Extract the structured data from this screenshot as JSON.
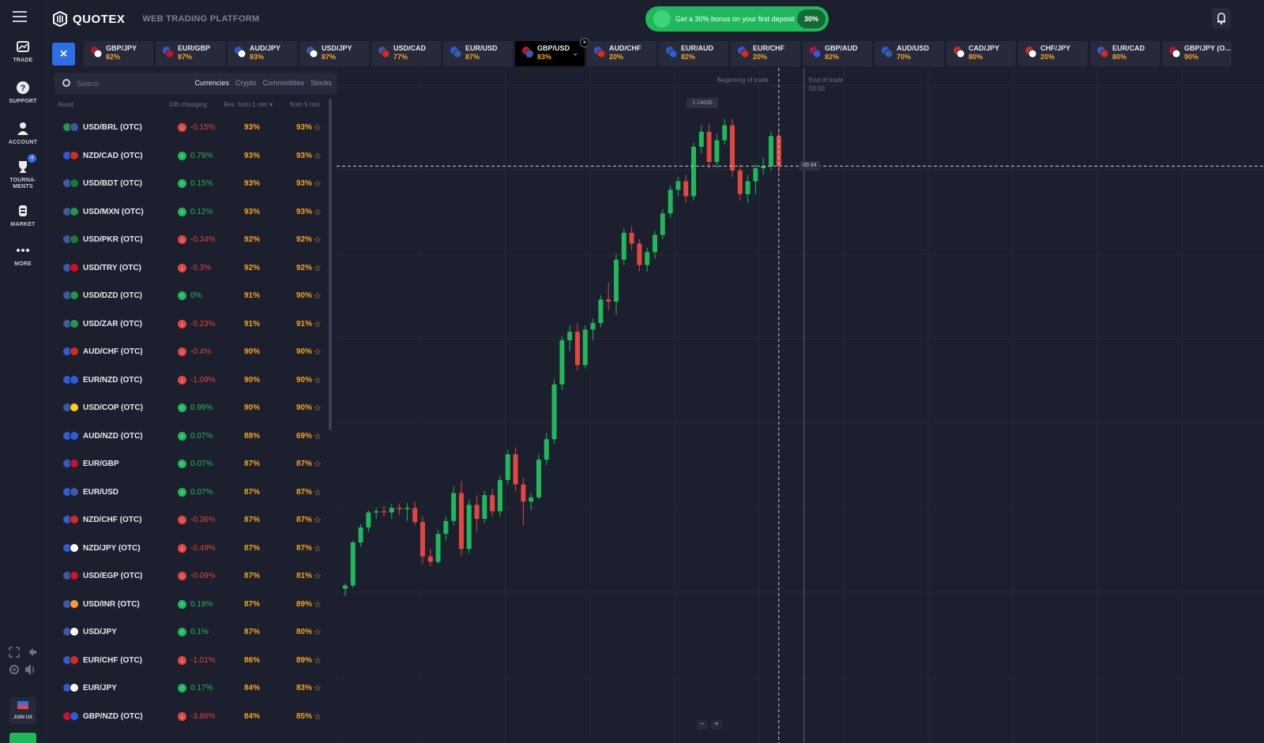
{
  "app": {
    "name": "QUOTEX",
    "subtitle": "WEB TRADING PLATFORM"
  },
  "rail": {
    "items": [
      {
        "label": "TRADE",
        "icon": "chart-icon"
      },
      {
        "label": "SUPPORT",
        "icon": "help-icon"
      },
      {
        "label": "ACCOUNT",
        "icon": "user-icon"
      },
      {
        "label": "TOURNA-\nMENTS",
        "icon": "trophy-icon",
        "badge": "4"
      },
      {
        "label": "MARKET",
        "icon": "coins-icon"
      },
      {
        "label": "MORE",
        "icon": "dots-icon"
      }
    ],
    "join_label": "JOIN US"
  },
  "promo": {
    "text": "Get a 30% bonus on your first deposit",
    "value": "30%"
  },
  "tabs": [
    {
      "name": "GBP/JPY",
      "pct": "82%",
      "colors": [
        "#c8102e",
        "#ffffff"
      ]
    },
    {
      "name": "EUR/GBP",
      "pct": "87%",
      "colors": [
        "#2f5bd6",
        "#c8102e"
      ]
    },
    {
      "name": "AUD/JPY",
      "pct": "83%",
      "colors": [
        "#2f5bd6",
        "#ffffff"
      ]
    },
    {
      "name": "USD/JPY",
      "pct": "87%",
      "colors": [
        "#3c5aa6",
        "#ffffff"
      ]
    },
    {
      "name": "USD/CAD",
      "pct": "77%",
      "colors": [
        "#3c5aa6",
        "#d52b1e"
      ]
    },
    {
      "name": "EUR/USD",
      "pct": "87%",
      "colors": [
        "#2f5bd6",
        "#3c5aa6"
      ]
    },
    {
      "name": "GBP/USD",
      "pct": "83%",
      "colors": [
        "#c8102e",
        "#3c5aa6"
      ],
      "active": true
    },
    {
      "name": "AUD/CHF",
      "pct": "20%",
      "colors": [
        "#2f5bd6",
        "#d52b1e"
      ]
    },
    {
      "name": "EUR/AUD",
      "pct": "82%",
      "colors": [
        "#2f5bd6",
        "#2f5bd6"
      ]
    },
    {
      "name": "EUR/CHF",
      "pct": "20%",
      "colors": [
        "#2f5bd6",
        "#d52b1e"
      ]
    },
    {
      "name": "GBP/AUD",
      "pct": "82%",
      "colors": [
        "#c8102e",
        "#2f5bd6"
      ]
    },
    {
      "name": "AUD/USD",
      "pct": "70%",
      "colors": [
        "#2f5bd6",
        "#3c5aa6"
      ]
    },
    {
      "name": "CAD/JPY",
      "pct": "80%",
      "colors": [
        "#d52b1e",
        "#ffffff"
      ]
    },
    {
      "name": "CHF/JPY",
      "pct": "20%",
      "colors": [
        "#d52b1e",
        "#ffffff"
      ]
    },
    {
      "name": "EUR/CAD",
      "pct": "80%",
      "colors": [
        "#2f5bd6",
        "#d52b1e"
      ]
    },
    {
      "name": "GBP/JPY (O...",
      "pct": "90%",
      "colors": [
        "#c8102e",
        "#ffffff"
      ]
    }
  ],
  "search": {
    "placeholder": "Search"
  },
  "categories": [
    "Currencies",
    "Crypto",
    "Commodities",
    "Stocks"
  ],
  "columns": {
    "asset": "Asset",
    "change": "24h changing",
    "rev1": "Rev. from 1 min ▾",
    "rev5": "from 5 min"
  },
  "assets": [
    {
      "name": "USD/BRL (OTC)",
      "change": "-0.15%",
      "dir": "down",
      "r1": "93%",
      "r5": "93%",
      "flags": [
        "#1f9a4a",
        "#3c5aa6"
      ]
    },
    {
      "name": "NZD/CAD (OTC)",
      "change": "0.79%",
      "dir": "up",
      "r1": "93%",
      "r5": "93%",
      "flags": [
        "#2f5bd6",
        "#d52b1e"
      ]
    },
    {
      "name": "USD/BDT (OTC)",
      "change": "0.15%",
      "dir": "up",
      "r1": "93%",
      "r5": "93%",
      "flags": [
        "#3c5aa6",
        "#0f7a43"
      ]
    },
    {
      "name": "USD/MXN (OTC)",
      "change": "0.12%",
      "dir": "up",
      "r1": "93%",
      "r5": "93%",
      "flags": [
        "#3c5aa6",
        "#1f9a4a"
      ]
    },
    {
      "name": "USD/PKR (OTC)",
      "change": "-0.34%",
      "dir": "down",
      "r1": "92%",
      "r5": "92%",
      "flags": [
        "#3c5aa6",
        "#1f7a3a"
      ]
    },
    {
      "name": "USD/TRY (OTC)",
      "change": "-0.3%",
      "dir": "down",
      "r1": "92%",
      "r5": "92%",
      "flags": [
        "#3c5aa6",
        "#e30a17"
      ]
    },
    {
      "name": "USD/DZD (OTC)",
      "change": "0%",
      "dir": "up",
      "r1": "91%",
      "r5": "90%",
      "flags": [
        "#3c5aa6",
        "#1f9a4a"
      ]
    },
    {
      "name": "USD/ZAR (OTC)",
      "change": "-0.23%",
      "dir": "down",
      "r1": "91%",
      "r5": "91%",
      "flags": [
        "#3c5aa6",
        "#1f9a4a"
      ]
    },
    {
      "name": "AUD/CHF (OTC)",
      "change": "-0.4%",
      "dir": "down",
      "r1": "90%",
      "r5": "90%",
      "flags": [
        "#2f5bd6",
        "#d52b1e"
      ]
    },
    {
      "name": "EUR/NZD (OTC)",
      "change": "-1.09%",
      "dir": "down",
      "r1": "90%",
      "r5": "90%",
      "flags": [
        "#2f5bd6",
        "#2f5bd6"
      ]
    },
    {
      "name": "USD/COP (OTC)",
      "change": "0.99%",
      "dir": "up",
      "r1": "90%",
      "r5": "90%",
      "flags": [
        "#3c5aa6",
        "#fcd116"
      ]
    },
    {
      "name": "AUD/NZD (OTC)",
      "change": "0.07%",
      "dir": "up",
      "r1": "88%",
      "r5": "69%",
      "flags": [
        "#2f5bd6",
        "#2f5bd6"
      ]
    },
    {
      "name": "EUR/GBP",
      "change": "0.07%",
      "dir": "up",
      "r1": "87%",
      "r5": "87%",
      "flags": [
        "#2f5bd6",
        "#c8102e"
      ]
    },
    {
      "name": "EUR/USD",
      "change": "0.07%",
      "dir": "up",
      "r1": "87%",
      "r5": "87%",
      "flags": [
        "#2f5bd6",
        "#3c5aa6"
      ]
    },
    {
      "name": "NZD/CHF (OTC)",
      "change": "-0.36%",
      "dir": "down",
      "r1": "87%",
      "r5": "87%",
      "flags": [
        "#2f5bd6",
        "#d52b1e"
      ]
    },
    {
      "name": "NZD/JPY (OTC)",
      "change": "-0.49%",
      "dir": "down",
      "r1": "87%",
      "r5": "87%",
      "flags": [
        "#2f5bd6",
        "#ffffff"
      ]
    },
    {
      "name": "USD/EGP (OTC)",
      "change": "-0.09%",
      "dir": "down",
      "r1": "87%",
      "r5": "81%",
      "flags": [
        "#3c5aa6",
        "#ce1126"
      ]
    },
    {
      "name": "USD/INR (OTC)",
      "change": "0.19%",
      "dir": "up",
      "r1": "87%",
      "r5": "89%",
      "flags": [
        "#3c5aa6",
        "#ff9933"
      ]
    },
    {
      "name": "USD/JPY",
      "change": "0.1%",
      "dir": "up",
      "r1": "87%",
      "r5": "80%",
      "flags": [
        "#3c5aa6",
        "#ffffff"
      ]
    },
    {
      "name": "EUR/CHF (OTC)",
      "change": "-1.01%",
      "dir": "down",
      "r1": "86%",
      "r5": "89%",
      "flags": [
        "#2f5bd6",
        "#d52b1e"
      ]
    },
    {
      "name": "EUR/JPY",
      "change": "0.17%",
      "dir": "up",
      "r1": "84%",
      "r5": "83%",
      "flags": [
        "#2f5bd6",
        "#ffffff"
      ]
    },
    {
      "name": "GBP/NZD (OTC)",
      "change": "-3.86%",
      "dir": "down",
      "r1": "84%",
      "r5": "85%",
      "flags": [
        "#c8102e",
        "#2f5bd6"
      ]
    }
  ],
  "chart": {
    "begin_label": "Beginning of trade",
    "end_label": "End of trade",
    "end_time": "03:00",
    "price_label": "1.24636",
    "timer": "00:34",
    "zoom_out": "−",
    "zoom_in": "+",
    "up_color": "#1fb85a",
    "down_color": "#e2463f",
    "candles": [
      [
        1.2145,
        1.215,
        1.2138,
        1.2148
      ],
      [
        1.2148,
        1.219,
        1.2146,
        1.2188
      ],
      [
        1.2188,
        1.2205,
        1.2184,
        1.2202
      ],
      [
        1.2202,
        1.2218,
        1.2198,
        1.2216
      ],
      [
        1.2216,
        1.222,
        1.221,
        1.2217
      ],
      [
        1.2217,
        1.2222,
        1.2212,
        1.2216
      ],
      [
        1.2216,
        1.2224,
        1.221,
        1.222
      ],
      [
        1.222,
        1.2224,
        1.2214,
        1.2219
      ],
      [
        1.2219,
        1.2225,
        1.2208,
        1.222
      ],
      [
        1.222,
        1.2226,
        1.2204,
        1.2207
      ],
      [
        1.2207,
        1.2212,
        1.2168,
        1.2175
      ],
      [
        1.2175,
        1.2182,
        1.2166,
        1.217
      ],
      [
        1.217,
        1.22,
        1.2168,
        1.2196
      ],
      [
        1.2196,
        1.2212,
        1.219,
        1.2208
      ],
      [
        1.2208,
        1.224,
        1.2204,
        1.2234
      ],
      [
        1.2234,
        1.2245,
        1.2176,
        1.2182
      ],
      [
        1.2182,
        1.2228,
        1.2178,
        1.2223
      ],
      [
        1.2223,
        1.2232,
        1.2198,
        1.221
      ],
      [
        1.221,
        1.2236,
        1.2206,
        1.2232
      ],
      [
        1.2232,
        1.2238,
        1.2212,
        1.2217
      ],
      [
        1.2217,
        1.225,
        1.2212,
        1.2246
      ],
      [
        1.2246,
        1.2274,
        1.2242,
        1.227
      ],
      [
        1.227,
        1.2276,
        1.2236,
        1.2242
      ],
      [
        1.2242,
        1.2248,
        1.2204,
        1.2226
      ],
      [
        1.2226,
        1.2234,
        1.2218,
        1.223
      ],
      [
        1.223,
        1.227,
        1.2228,
        1.2265
      ],
      [
        1.2265,
        1.229,
        1.226,
        1.2284
      ],
      [
        1.2284,
        1.234,
        1.228,
        1.2335
      ],
      [
        1.2335,
        1.238,
        1.233,
        1.2376
      ],
      [
        1.2376,
        1.239,
        1.2366,
        1.2384
      ],
      [
        1.2384,
        1.2392,
        1.2348,
        1.2353
      ],
      [
        1.2353,
        1.239,
        1.235,
        1.2386
      ],
      [
        1.2386,
        1.2396,
        1.2376,
        1.2392
      ],
      [
        1.2392,
        1.2418,
        1.2388,
        1.2414
      ],
      [
        1.2414,
        1.243,
        1.2404,
        1.2412
      ],
      [
        1.2412,
        1.2456,
        1.24,
        1.2451
      ],
      [
        1.2451,
        1.248,
        1.2446,
        1.2476
      ],
      [
        1.2476,
        1.2482,
        1.246,
        1.2466
      ],
      [
        1.2466,
        1.247,
        1.244,
        1.2446
      ],
      [
        1.2446,
        1.2462,
        1.244,
        1.2458
      ],
      [
        1.2458,
        1.2478,
        1.2452,
        1.2474
      ],
      [
        1.2474,
        1.2498,
        1.247,
        1.2494
      ],
      [
        1.2494,
        1.252,
        1.249,
        1.2516
      ],
      [
        1.2516,
        1.2528,
        1.251,
        1.2524
      ],
      [
        1.2524,
        1.253,
        1.2504,
        1.251
      ],
      [
        1.251,
        1.256,
        1.2506,
        1.2556
      ],
      [
        1.2556,
        1.2576,
        1.255,
        1.257
      ],
      [
        1.257,
        1.2578,
        1.2536,
        1.2542
      ],
      [
        1.2542,
        1.2568,
        1.2536,
        1.2562
      ],
      [
        1.2562,
        1.2582,
        1.2558,
        1.2576
      ],
      [
        1.2576,
        1.2582,
        1.2528,
        1.2534
      ],
      [
        1.2534,
        1.254,
        1.2506,
        1.2512
      ],
      [
        1.2512,
        1.253,
        1.2504,
        1.2524
      ],
      [
        1.2524,
        1.254,
        1.2512,
        1.2536
      ],
      [
        1.2536,
        1.2546,
        1.253,
        1.2538
      ],
      [
        1.2538,
        1.257,
        1.2534,
        1.2566
      ],
      [
        1.2566,
        1.2572,
        1.2532,
        1.2538
      ]
    ],
    "ylim": [
      1.213,
      1.26
    ]
  }
}
